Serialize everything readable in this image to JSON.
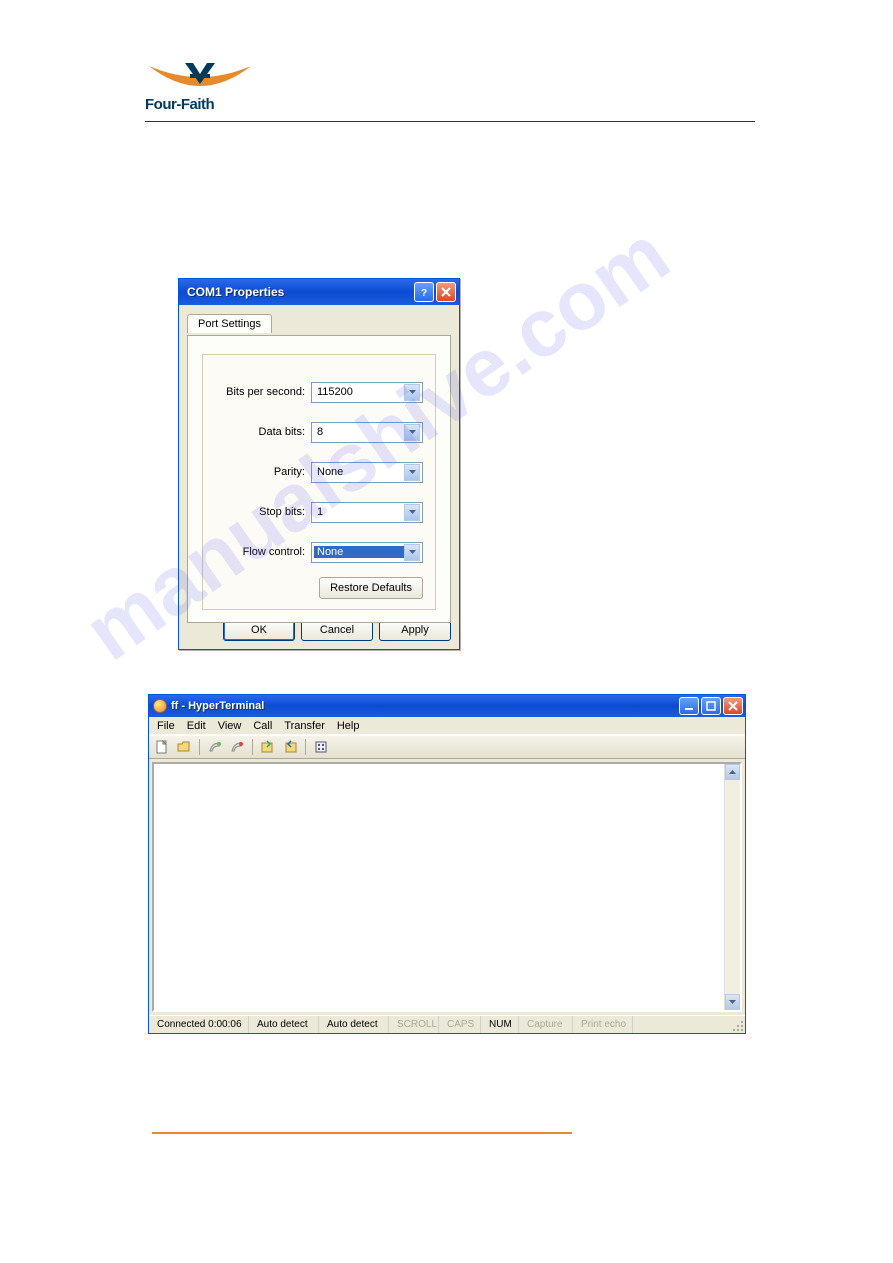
{
  "logo": {
    "text": "Four-Faith"
  },
  "watermark": "manualshive.com",
  "com_dialog": {
    "title": "COM1 Properties",
    "tab": "Port Settings",
    "fields": {
      "bits_label": "Bits per second:",
      "bits_value": "115200",
      "data_label": "Data bits:",
      "data_value": "8",
      "parity_label": "Parity:",
      "parity_value": "None",
      "stop_label": "Stop bits:",
      "stop_value": "1",
      "flow_label": "Flow control:",
      "flow_value": "None"
    },
    "restore": "Restore Defaults",
    "ok": "OK",
    "cancel": "Cancel",
    "apply": "Apply"
  },
  "ht": {
    "title": "ff - HyperTerminal",
    "menu": [
      "File",
      "Edit",
      "View",
      "Call",
      "Transfer",
      "Help"
    ],
    "status": {
      "connected": "Connected 0:00:06",
      "auto1": "Auto detect",
      "auto2": "Auto detect",
      "scroll": "SCROLL",
      "caps": "CAPS",
      "num": "NUM",
      "capture": "Capture",
      "printecho": "Print echo"
    }
  }
}
